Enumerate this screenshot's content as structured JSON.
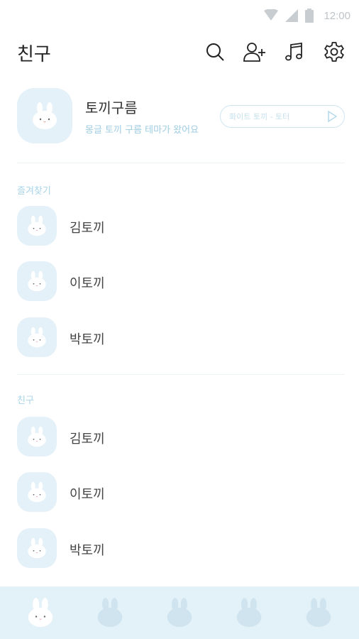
{
  "status_bar": {
    "time": "12:00"
  },
  "header": {
    "title": "친구"
  },
  "profile": {
    "name": "토끼구름",
    "status_message": "몽글 토끼 구름 테마가 왔어요",
    "music_text": "화이트 토끼 - 토터"
  },
  "sections": {
    "favorites_label": "즐겨찾기",
    "friends_label": "친구"
  },
  "favorites": [
    {
      "name": "김토끼"
    },
    {
      "name": "이토끼"
    },
    {
      "name": "박토끼"
    }
  ],
  "friends": [
    {
      "name": "김토끼"
    },
    {
      "name": "이토끼"
    },
    {
      "name": "박토끼"
    }
  ],
  "icons": {
    "header": [
      "search-icon",
      "add-friend-icon",
      "music-note-icon",
      "settings-gear-icon"
    ],
    "tabs": [
      "friends-tab-icon",
      "chats-tab-icon",
      "view-tab-icon",
      "shopping-tab-icon",
      "more-tab-icon"
    ]
  },
  "colors": {
    "accent": "#9fcde3",
    "avatar_bg": "#e4f1f8",
    "tab_bar_bg": "#e3f1f8",
    "tab_inactive": "#cfe4ef",
    "tab_active": "#ffffff"
  }
}
